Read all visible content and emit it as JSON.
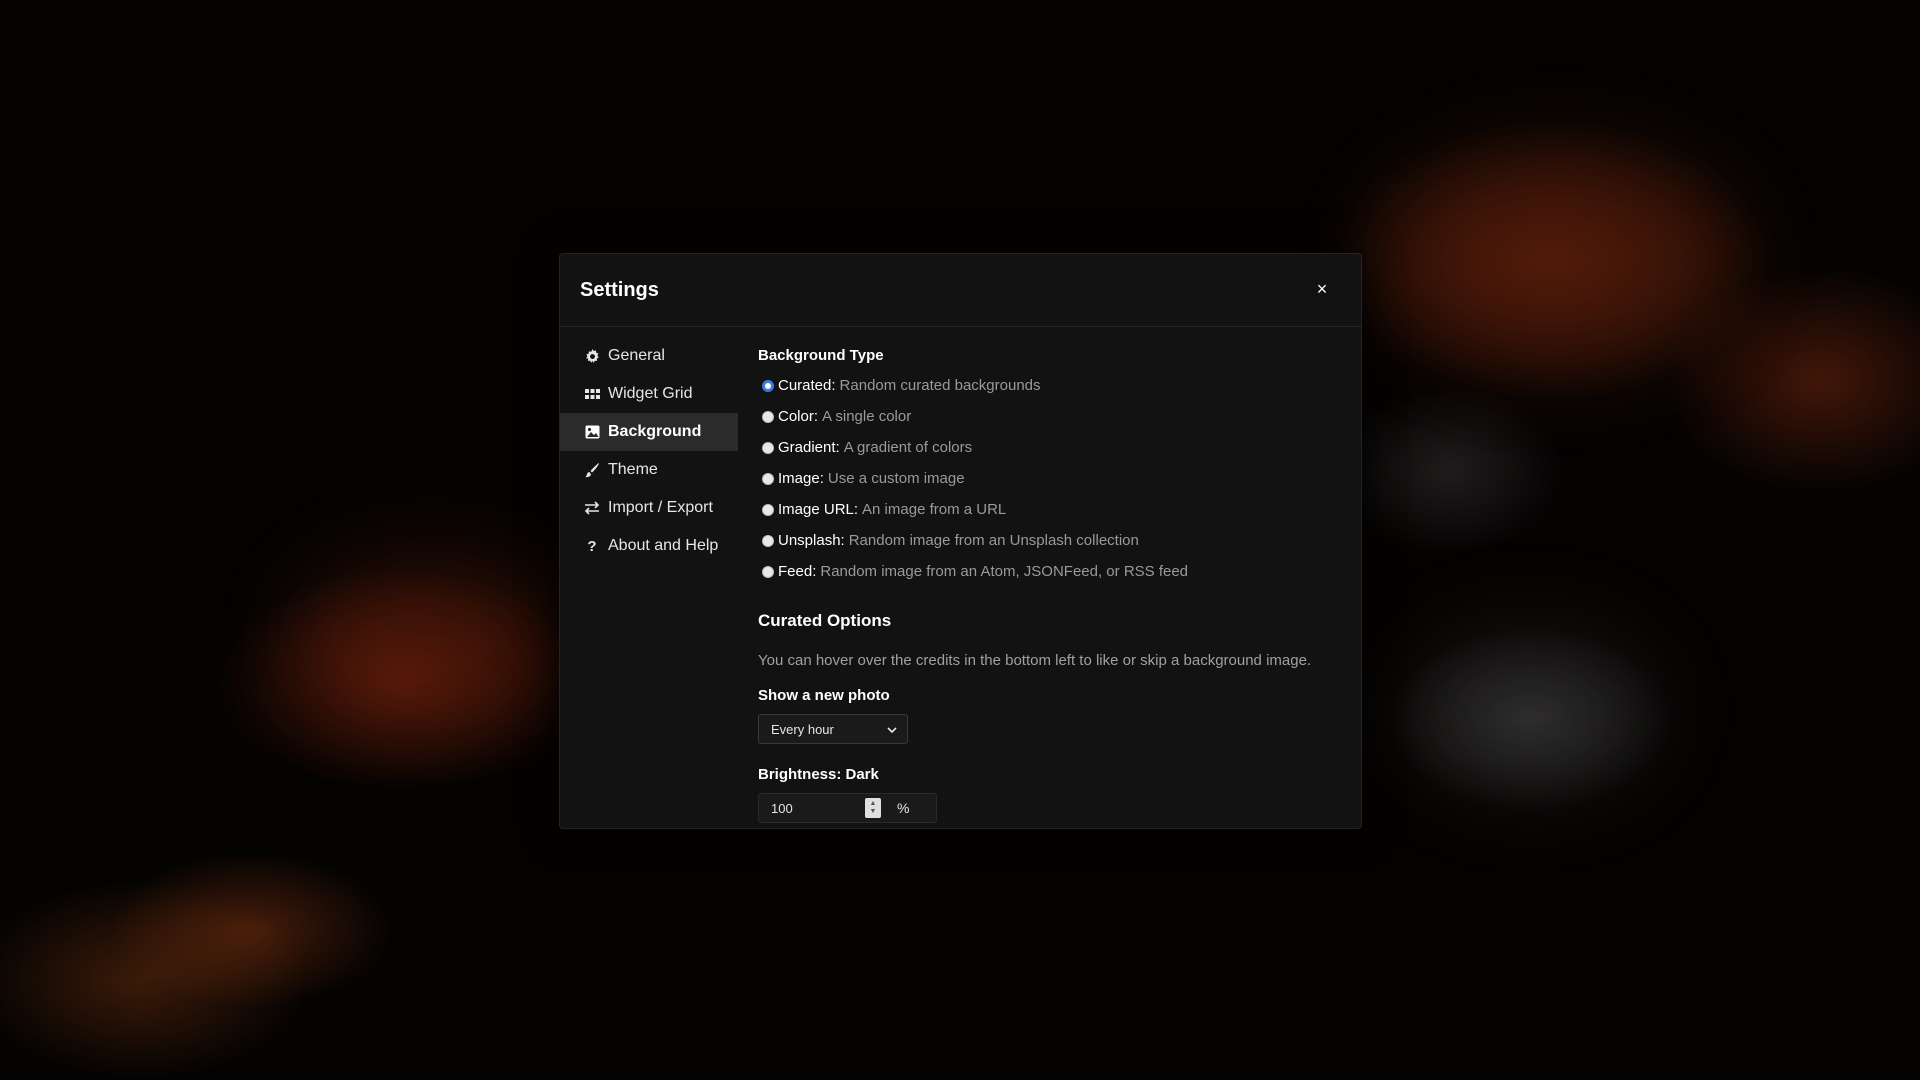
{
  "background": {
    "credits": "",
    "footer_links": [
      "",
      "",
      ""
    ]
  },
  "modal": {
    "title": "Settings",
    "close_label": "×"
  },
  "sidebar": {
    "items": [
      {
        "label": "General",
        "icon": "gear-icon",
        "active": false
      },
      {
        "label": "Widget Grid",
        "icon": "grid-icon",
        "active": false
      },
      {
        "label": "Background",
        "icon": "image-icon",
        "active": true
      },
      {
        "label": "Theme",
        "icon": "brush-icon",
        "active": false
      },
      {
        "label": "Import / Export",
        "icon": "swap-arrows-icon",
        "active": false
      },
      {
        "label": "About and Help",
        "icon": "question-icon",
        "active": false
      }
    ]
  },
  "background_type": {
    "heading": "Background Type",
    "options": [
      {
        "label": "Curated:",
        "description": "Random curated backgrounds",
        "checked": true
      },
      {
        "label": "Color:",
        "description": "A single color",
        "checked": false
      },
      {
        "label": "Gradient:",
        "description": "A gradient of colors",
        "checked": false
      },
      {
        "label": "Image:",
        "description": "Use a custom image",
        "checked": false
      },
      {
        "label": "Image URL:",
        "description": "An image from a URL",
        "checked": false
      },
      {
        "label": "Unsplash:",
        "description": "Random image from an Unsplash collection",
        "checked": false
      },
      {
        "label": "Feed:",
        "description": "Random image from an Atom, JSONFeed, or RSS feed",
        "checked": false
      }
    ]
  },
  "curated_options": {
    "heading": "Curated Options",
    "help_text": "You can hover over the credits in the bottom left to like or skip a background image.",
    "show_photo_label": "Show a new photo",
    "show_photo_value": "Every hour",
    "brightness_label": "Brightness: Dark",
    "brightness_value": "100",
    "brightness_unit": "%"
  },
  "colors": {
    "accent": "#3b7ddd",
    "modal_bg": "#121212",
    "active_nav_bg": "#2b2b2b",
    "muted_text": "#9a9a9a"
  }
}
